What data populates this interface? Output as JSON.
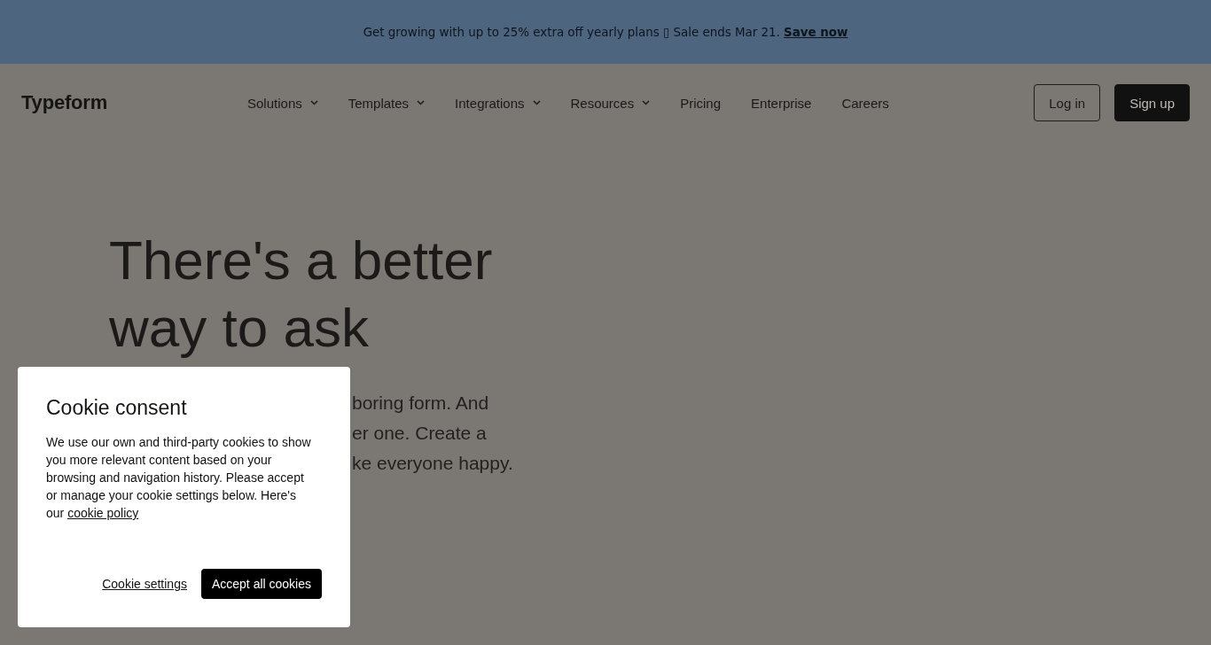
{
  "promo_banner": {
    "text": "Get growing with up to 25% extra off yearly plans ▯ Sale ends Mar 21.",
    "link": "Save now"
  },
  "header": {
    "logo": "Typeform",
    "nav": [
      {
        "label": "Solutions",
        "has_menu": true
      },
      {
        "label": "Templates",
        "has_menu": true
      },
      {
        "label": "Integrations",
        "has_menu": true
      },
      {
        "label": "Resources",
        "has_menu": true
      },
      {
        "label": "Pricing",
        "has_menu": false
      },
      {
        "label": "Enterprise",
        "has_menu": false
      },
      {
        "label": "Careers",
        "has_menu": false
      }
    ],
    "buttons": [
      {
        "label": "Log in",
        "kind": "outline"
      },
      {
        "label": "Sign up",
        "kind": "solid"
      }
    ]
  },
  "hero": {
    "title": "There's a better way to ask",
    "subtext_lines": [
      "boring form. And",
      "er one. Create a",
      "ke everyone happy."
    ]
  },
  "cookie_dialog": {
    "title": "Cookie consent",
    "body": "We use our own and third-party cookies to show you more relevant content based on your browsing and navigation history. Please accept or manage your cookie settings below. Here's our",
    "policy_link": "cookie policy",
    "settings_link": "Cookie settings",
    "accept_button": "Accept all cookies"
  }
}
